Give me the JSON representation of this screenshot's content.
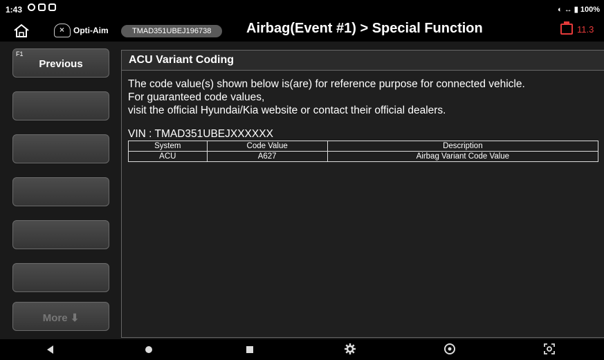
{
  "status_bar": {
    "time": "1:43",
    "right": "◐ ↔ ▮ 100%"
  },
  "header": {
    "brand": "Opti-Aim",
    "vin": "TMAD351UBEJ196738",
    "title": "Airbag(Event #1) > Special Function",
    "battery_voltage": "11.3"
  },
  "function_keys": [
    {
      "fnum": "F1",
      "label": "Previous",
      "enabled": true
    },
    {
      "fnum": "",
      "label": "",
      "enabled": true
    },
    {
      "fnum": "",
      "label": "",
      "enabled": true
    },
    {
      "fnum": "",
      "label": "",
      "enabled": true
    },
    {
      "fnum": "",
      "label": "",
      "enabled": true
    },
    {
      "fnum": "",
      "label": "",
      "enabled": true
    },
    {
      "fnum": "",
      "label": "More ⬇",
      "enabled": false
    }
  ],
  "panel": {
    "title": "ACU Variant Coding",
    "notice_lines": [
      "The code value(s) shown below is(are) for reference purpose for connected vehicle.",
      "For guaranteed code values,",
      "visit the official Hyundai/Kia website or contact their official dealers."
    ],
    "vin_line": "VIN : TMAD351UBEJXXXXXX",
    "table": {
      "headers": [
        "System",
        "Code Value",
        "Description"
      ],
      "rows": [
        [
          "ACU",
          "A627",
          "Airbag Variant Code Value"
        ]
      ]
    }
  },
  "navbar": [
    "back-icon",
    "home-icon",
    "recents-icon",
    "settings-icon",
    "browser-icon",
    "screenshot-icon"
  ]
}
